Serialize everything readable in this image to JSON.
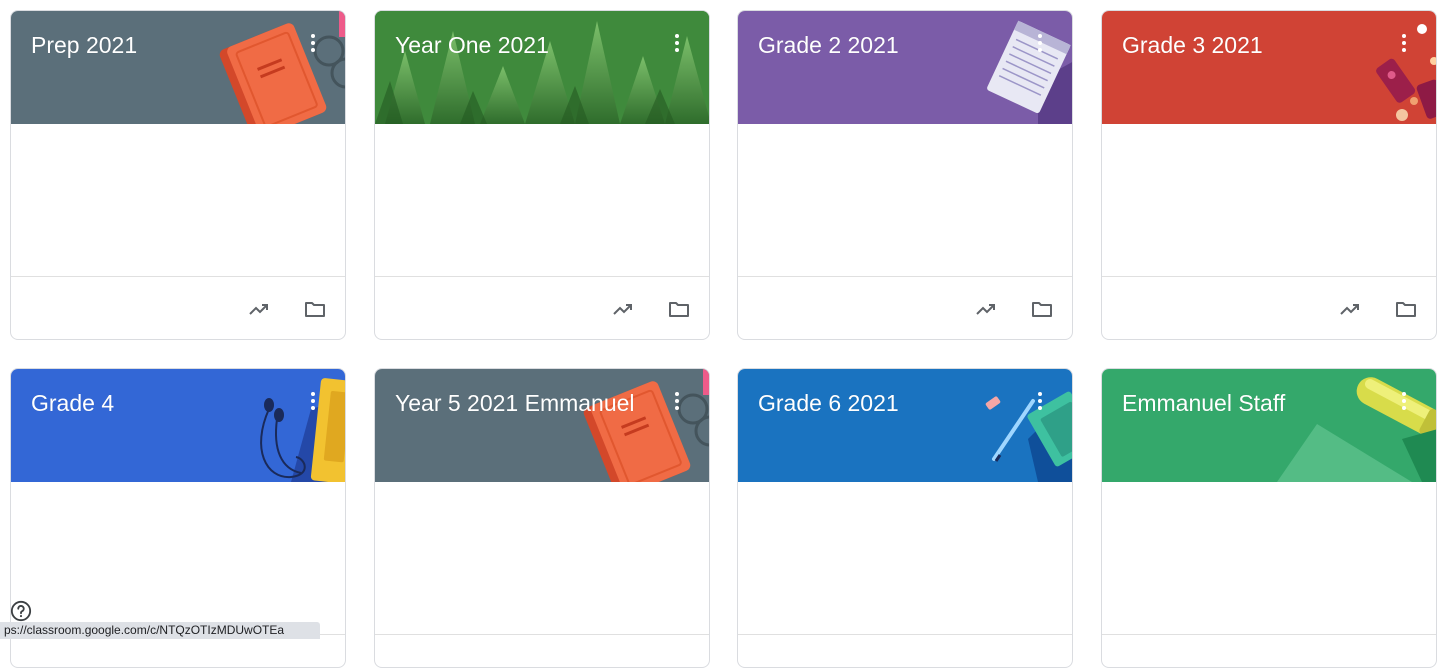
{
  "classes": [
    {
      "name": "Prep 2021",
      "theme_color": "#5b6f7a",
      "art": "book"
    },
    {
      "name": "Year One 2021",
      "theme_color": "#3d8a3a",
      "art": "pencils"
    },
    {
      "name": "Grade 2 2021",
      "theme_color": "#7b5ca8",
      "art": "notepad"
    },
    {
      "name": "Grade 3 2021",
      "theme_color": "#d04335",
      "art": "supplies"
    },
    {
      "name": "Grade 4",
      "theme_color": "#3367d6",
      "art": "earphones"
    },
    {
      "name": "Year 5 2021 Emmanuel",
      "theme_color": "#5b6f7a",
      "art": "book"
    },
    {
      "name": "Grade 6 2021",
      "theme_color": "#1a73c0",
      "art": "pens"
    },
    {
      "name": "Emmanuel Staff",
      "theme_color": "#34a86b",
      "art": "tube"
    }
  ],
  "card_icons": {
    "menu": "more-vert-icon",
    "trend": "trending-up-icon",
    "folder": "folder-icon"
  },
  "help_icon": "help-circle-icon",
  "status_bar_url": "ps://classroom.google.com/c/NTQzOTIzMDUwOTEa"
}
